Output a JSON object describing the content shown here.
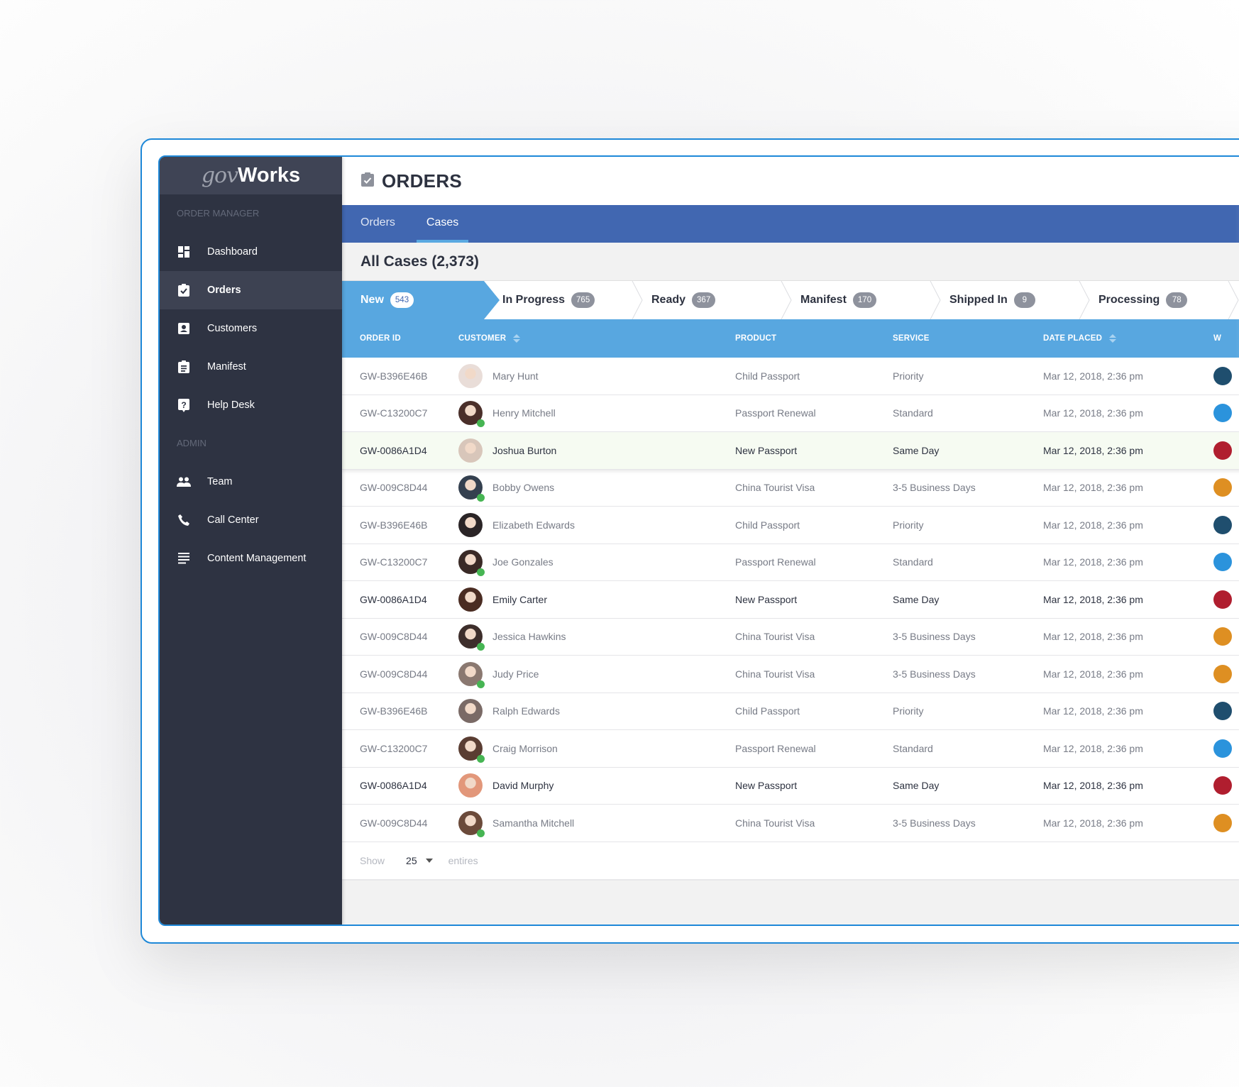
{
  "app": {
    "logo_prefix": "gov",
    "logo_suffix": "Works"
  },
  "sidebar": {
    "sections": [
      {
        "label": "ORDER MANAGER",
        "items": [
          {
            "label": "Dashboard",
            "icon": "dashboard-icon",
            "active": false
          },
          {
            "label": "Orders",
            "icon": "clipboard-check-icon",
            "active": true
          },
          {
            "label": "Customers",
            "icon": "contact-card-icon",
            "active": false
          },
          {
            "label": "Manifest",
            "icon": "clipboard-list-icon",
            "active": false
          },
          {
            "label": "Help Desk",
            "icon": "help-icon",
            "active": false
          }
        ]
      },
      {
        "label": "ADMIN",
        "items": [
          {
            "label": "Team",
            "icon": "people-icon",
            "active": false
          },
          {
            "label": "Call Center",
            "icon": "phone-icon",
            "active": false
          },
          {
            "label": "Content Management",
            "icon": "text-lines-icon",
            "active": false
          }
        ]
      }
    ]
  },
  "header": {
    "title": "ORDERS",
    "icon": "clipboard-check-icon"
  },
  "tabs": [
    {
      "label": "Orders",
      "active": false
    },
    {
      "label": "Cases",
      "active": true
    }
  ],
  "section_title": "All Cases (2,373)",
  "pipeline": [
    {
      "label": "New",
      "count": "543",
      "active": true
    },
    {
      "label": "In Progress",
      "count": "765",
      "active": false
    },
    {
      "label": "Ready",
      "count": "367",
      "active": false
    },
    {
      "label": "Manifest",
      "count": "170",
      "active": false
    },
    {
      "label": "Shipped In",
      "count": "9",
      "active": false
    },
    {
      "label": "Processing",
      "count": "78",
      "active": false
    }
  ],
  "table": {
    "columns": {
      "order_id": "ORDER ID",
      "customer": "CUSTOMER",
      "product": "PRODUCT",
      "service": "SERVICE",
      "date_placed": "DATE PLACED",
      "extra": "W"
    },
    "rows": [
      {
        "order_id": "GW-B396E46B",
        "customer": "Mary Hunt",
        "online": false,
        "product": "Child Passport",
        "service": "Priority",
        "date": "Mar 12, 2018, 2:36 pm",
        "status_color": "#1f4e6e",
        "bold": false,
        "highlight": false,
        "avatar_color": "#e9ddd8"
      },
      {
        "order_id": "GW-C13200C7",
        "customer": "Henry Mitchell",
        "online": true,
        "product": "Passport Renewal",
        "service": "Standard",
        "date": "Mar 12, 2018, 2:36 pm",
        "status_color": "#2b93dc",
        "bold": false,
        "highlight": false,
        "avatar_color": "#4a2f2a"
      },
      {
        "order_id": "GW-0086A1D4",
        "customer": "Joshua Burton",
        "online": false,
        "product": "New Passport",
        "service": "Same Day",
        "date": "Mar 12, 2018, 2:36 pm",
        "status_color": "#b01e2f",
        "bold": true,
        "highlight": true,
        "avatar_color": "#d8c6ba"
      },
      {
        "order_id": "GW-009C8D44",
        "customer": "Bobby Owens",
        "online": true,
        "product": "China Tourist Visa",
        "service": "3-5 Business Days",
        "date": "Mar 12, 2018, 2:36 pm",
        "status_color": "#de8f22",
        "bold": false,
        "highlight": false,
        "avatar_color": "#34404f"
      },
      {
        "order_id": "GW-B396E46B",
        "customer": "Elizabeth Edwards",
        "online": false,
        "product": "Child Passport",
        "service": "Priority",
        "date": "Mar 12, 2018, 2:36 pm",
        "status_color": "#1f4e6e",
        "bold": false,
        "highlight": false,
        "avatar_color": "#2a2426"
      },
      {
        "order_id": "GW-C13200C7",
        "customer": "Joe Gonzales",
        "online": true,
        "product": "Passport Renewal",
        "service": "Standard",
        "date": "Mar 12, 2018, 2:36 pm",
        "status_color": "#2b93dc",
        "bold": false,
        "highlight": false,
        "avatar_color": "#3a2a26"
      },
      {
        "order_id": "GW-0086A1D4",
        "customer": "Emily Carter",
        "online": false,
        "product": "New Passport",
        "service": "Same Day",
        "date": "Mar 12, 2018, 2:36 pm",
        "status_color": "#b01e2f",
        "bold": true,
        "highlight": false,
        "avatar_color": "#4a2c22"
      },
      {
        "order_id": "GW-009C8D44",
        "customer": "Jessica Hawkins",
        "online": true,
        "product": "China Tourist Visa",
        "service": "3-5 Business Days",
        "date": "Mar 12, 2018, 2:36 pm",
        "status_color": "#de8f22",
        "bold": false,
        "highlight": false,
        "avatar_color": "#3d2e2b"
      },
      {
        "order_id": "GW-009C8D44",
        "customer": "Judy Price",
        "online": true,
        "product": "China Tourist Visa",
        "service": "3-5 Business Days",
        "date": "Mar 12, 2018, 2:36 pm",
        "status_color": "#de8f22",
        "bold": false,
        "highlight": false,
        "avatar_color": "#8a7870"
      },
      {
        "order_id": "GW-B396E46B",
        "customer": "Ralph Edwards",
        "online": false,
        "product": "Child Passport",
        "service": "Priority",
        "date": "Mar 12, 2018, 2:36 pm",
        "status_color": "#1f4e6e",
        "bold": false,
        "highlight": false,
        "avatar_color": "#7a6a66"
      },
      {
        "order_id": "GW-C13200C7",
        "customer": "Craig Morrison",
        "online": true,
        "product": "Passport Renewal",
        "service": "Standard",
        "date": "Mar 12, 2018, 2:36 pm",
        "status_color": "#2b93dc",
        "bold": false,
        "highlight": false,
        "avatar_color": "#5a3d32"
      },
      {
        "order_id": "GW-0086A1D4",
        "customer": "David Murphy",
        "online": false,
        "product": "New Passport",
        "service": "Same Day",
        "date": "Mar 12, 2018, 2:36 pm",
        "status_color": "#b01e2f",
        "bold": true,
        "highlight": false,
        "avatar_color": "#e2977a"
      },
      {
        "order_id": "GW-009C8D44",
        "customer": "Samantha Mitchell",
        "online": true,
        "product": "China Tourist Visa",
        "service": "3-5 Business Days",
        "date": "Mar 12, 2018, 2:36 pm",
        "status_color": "#de8f22",
        "bold": false,
        "highlight": false,
        "avatar_color": "#6b4a3a"
      }
    ]
  },
  "footer": {
    "show_label": "Show",
    "page_size": "25",
    "entries_label": "entires"
  }
}
